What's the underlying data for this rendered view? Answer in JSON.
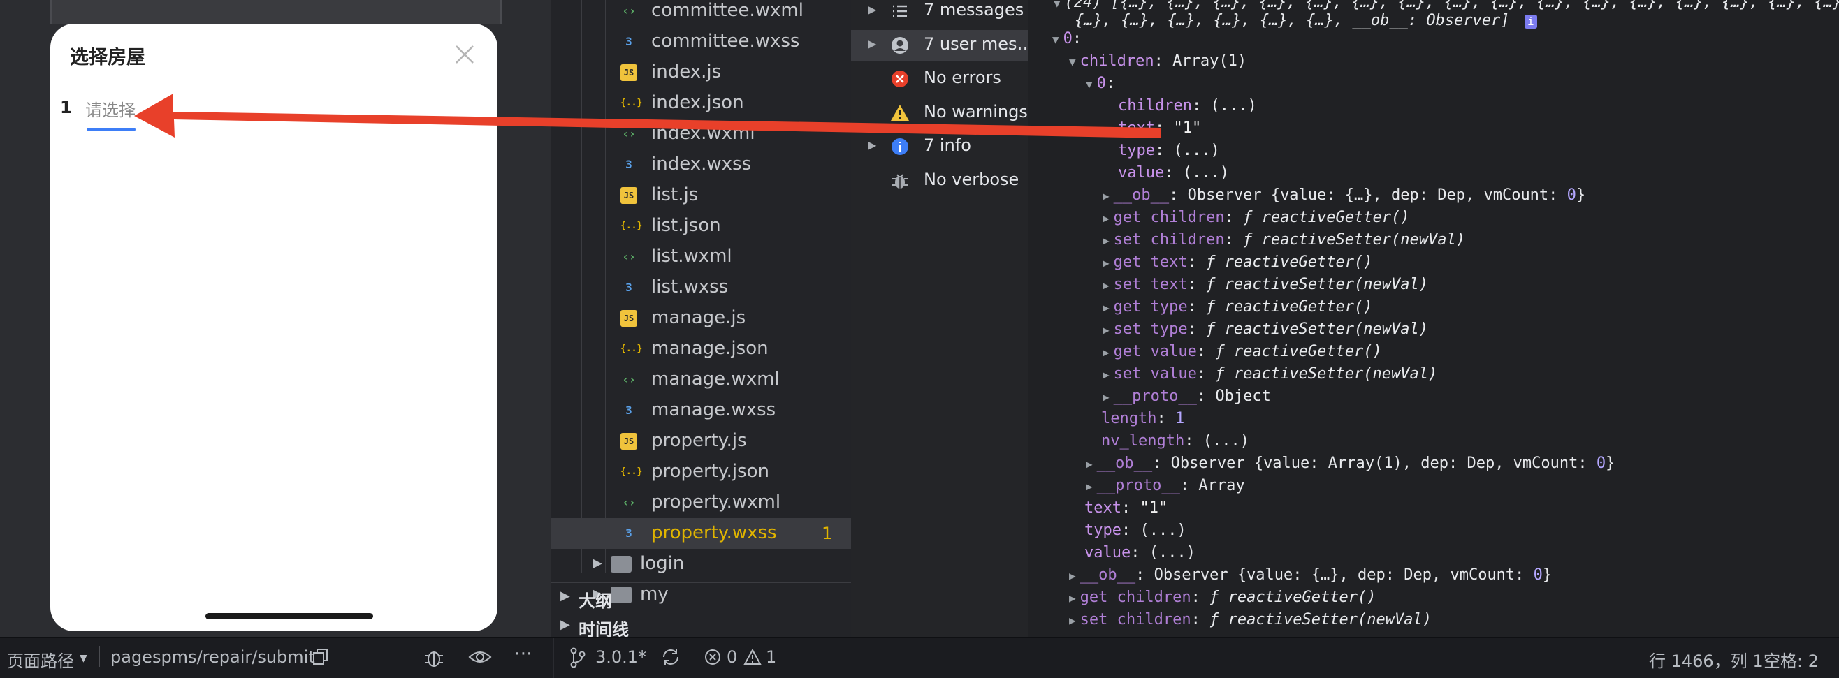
{
  "simulator": {
    "sheet_title": "选择房屋",
    "step_number": "1",
    "step_tab_label": "请选择"
  },
  "file_tree": {
    "files": [
      {
        "name": "committee.wxml",
        "type": "wxml"
      },
      {
        "name": "committee.wxss",
        "type": "wxss"
      },
      {
        "name": "index.js",
        "type": "js"
      },
      {
        "name": "index.json",
        "type": "json"
      },
      {
        "name": "index.wxml",
        "type": "wxml"
      },
      {
        "name": "index.wxss",
        "type": "wxss"
      },
      {
        "name": "list.js",
        "type": "js"
      },
      {
        "name": "list.json",
        "type": "json"
      },
      {
        "name": "list.wxml",
        "type": "wxml"
      },
      {
        "name": "list.wxss",
        "type": "wxss"
      },
      {
        "name": "manage.js",
        "type": "js"
      },
      {
        "name": "manage.json",
        "type": "json"
      },
      {
        "name": "manage.wxml",
        "type": "wxml"
      },
      {
        "name": "manage.wxss",
        "type": "wxss"
      },
      {
        "name": "property.js",
        "type": "js"
      },
      {
        "name": "property.json",
        "type": "json"
      },
      {
        "name": "property.wxml",
        "type": "wxml"
      },
      {
        "name": "property.wxss",
        "type": "wxss",
        "badge": "1",
        "selected": true
      }
    ],
    "folders": [
      "login",
      "my"
    ],
    "outline_label": "大纲",
    "timeline_label": "时间线"
  },
  "console_filters": [
    {
      "label": "7 messages",
      "icon": "list-icon",
      "expandable": true
    },
    {
      "label": "7 user mes…",
      "icon": "user-icon",
      "expandable": true,
      "selected": true
    },
    {
      "label": "No errors",
      "icon": "error-icon",
      "expandable": false
    },
    {
      "label": "No warnings",
      "icon": "warning-icon",
      "expandable": false
    },
    {
      "label": "7 info",
      "icon": "info-icon",
      "expandable": true
    },
    {
      "label": "No verbose",
      "icon": "bug-icon",
      "expandable": false
    }
  ],
  "console_output": {
    "header_line_1": "(24) [{…}, {…}, {…}, {…}, {…}, {…}, {…}, {…}, {…}, {…}, {…}, {…}, {…}, {…}, {…}, {…}, {…},",
    "header_line_2": "{…}, {…}, {…}, {…}, {…}, {…}, __ob__: Observer]",
    "info_badge": "i",
    "lines": [
      {
        "indent": 1,
        "tri": "down",
        "parts": [
          {
            "t": "0",
            "c": "k"
          },
          {
            "t": ":"
          }
        ]
      },
      {
        "indent": 2,
        "tri": "down",
        "parts": [
          {
            "t": "children",
            "c": "k"
          },
          {
            "t": ": Array(1)"
          }
        ]
      },
      {
        "indent": 3,
        "tri": "down",
        "parts": [
          {
            "t": "0",
            "c": "k"
          },
          {
            "t": ":"
          }
        ]
      },
      {
        "indent": 4,
        "tri": "",
        "parts": [
          {
            "t": "children",
            "c": "k"
          },
          {
            "t": ": (...)"
          }
        ]
      },
      {
        "indent": 4,
        "tri": "",
        "parts": [
          {
            "t": "text",
            "c": "k"
          },
          {
            "t": ": "
          },
          {
            "t": "\"1\"",
            "c": "s"
          }
        ]
      },
      {
        "indent": 4,
        "tri": "",
        "parts": [
          {
            "t": "type",
            "c": "k"
          },
          {
            "t": ": (...)"
          }
        ]
      },
      {
        "indent": 4,
        "tri": "",
        "parts": [
          {
            "t": "value",
            "c": "k"
          },
          {
            "t": ": (...)"
          }
        ]
      },
      {
        "indent": 4,
        "tri": "right",
        "parts": [
          {
            "t": "__ob__",
            "c": "kd"
          },
          {
            "t": ": Observer {value: {…}, dep: Dep, vmCount: "
          },
          {
            "t": "0",
            "c": "n"
          },
          {
            "t": "}"
          }
        ]
      },
      {
        "indent": 4,
        "tri": "right",
        "parts": [
          {
            "t": "get children",
            "c": "kd"
          },
          {
            "t": ": "
          },
          {
            "t": "ƒ reactiveGetter()",
            "c": "f"
          }
        ]
      },
      {
        "indent": 4,
        "tri": "right",
        "parts": [
          {
            "t": "set children",
            "c": "kd"
          },
          {
            "t": ": "
          },
          {
            "t": "ƒ reactiveSetter(newVal)",
            "c": "f"
          }
        ]
      },
      {
        "indent": 4,
        "tri": "right",
        "parts": [
          {
            "t": "get text",
            "c": "kd"
          },
          {
            "t": ": "
          },
          {
            "t": "ƒ reactiveGetter()",
            "c": "f"
          }
        ]
      },
      {
        "indent": 4,
        "tri": "right",
        "parts": [
          {
            "t": "set text",
            "c": "kd"
          },
          {
            "t": ": "
          },
          {
            "t": "ƒ reactiveSetter(newVal)",
            "c": "f"
          }
        ]
      },
      {
        "indent": 4,
        "tri": "right",
        "parts": [
          {
            "t": "get type",
            "c": "kd"
          },
          {
            "t": ": "
          },
          {
            "t": "ƒ reactiveGetter()",
            "c": "f"
          }
        ]
      },
      {
        "indent": 4,
        "tri": "right",
        "parts": [
          {
            "t": "set type",
            "c": "kd"
          },
          {
            "t": ": "
          },
          {
            "t": "ƒ reactiveSetter(newVal)",
            "c": "f"
          }
        ]
      },
      {
        "indent": 4,
        "tri": "right",
        "parts": [
          {
            "t": "get value",
            "c": "kd"
          },
          {
            "t": ": "
          },
          {
            "t": "ƒ reactiveGetter()",
            "c": "f"
          }
        ]
      },
      {
        "indent": 4,
        "tri": "right",
        "parts": [
          {
            "t": "set value",
            "c": "kd"
          },
          {
            "t": ": "
          },
          {
            "t": "ƒ reactiveSetter(newVal)",
            "c": "f"
          }
        ]
      },
      {
        "indent": 4,
        "tri": "right",
        "parts": [
          {
            "t": "__proto__",
            "c": "kd"
          },
          {
            "t": ": Object"
          }
        ]
      },
      {
        "indent": 3,
        "tri": "",
        "parts": [
          {
            "t": "length",
            "c": "kd"
          },
          {
            "t": ": "
          },
          {
            "t": "1",
            "c": "n"
          }
        ]
      },
      {
        "indent": 3,
        "tri": "",
        "parts": [
          {
            "t": "nv_length",
            "c": "kd"
          },
          {
            "t": ": (...)"
          }
        ]
      },
      {
        "indent": 3,
        "tri": "right",
        "parts": [
          {
            "t": "__ob__",
            "c": "kd"
          },
          {
            "t": ": Observer {value: Array(1), dep: Dep, vmCount: "
          },
          {
            "t": "0",
            "c": "n"
          },
          {
            "t": "}"
          }
        ]
      },
      {
        "indent": 3,
        "tri": "right",
        "parts": [
          {
            "t": "__proto__",
            "c": "kd"
          },
          {
            "t": ": Array"
          }
        ]
      },
      {
        "indent": 2,
        "tri": "",
        "parts": [
          {
            "t": "text",
            "c": "k"
          },
          {
            "t": ": "
          },
          {
            "t": "\"1\"",
            "c": "s"
          }
        ]
      },
      {
        "indent": 2,
        "tri": "",
        "parts": [
          {
            "t": "type",
            "c": "k"
          },
          {
            "t": ": (...)"
          }
        ]
      },
      {
        "indent": 2,
        "tri": "",
        "parts": [
          {
            "t": "value",
            "c": "k"
          },
          {
            "t": ": (...)"
          }
        ]
      },
      {
        "indent": 2,
        "tri": "right",
        "parts": [
          {
            "t": "__ob__",
            "c": "kd"
          },
          {
            "t": ": Observer {value: {…}, dep: Dep, vmCount: "
          },
          {
            "t": "0",
            "c": "n"
          },
          {
            "t": "}"
          }
        ]
      },
      {
        "indent": 2,
        "tri": "right",
        "parts": [
          {
            "t": "get children",
            "c": "kd"
          },
          {
            "t": ": "
          },
          {
            "t": "ƒ reactiveGetter()",
            "c": "f"
          }
        ]
      },
      {
        "indent": 2,
        "tri": "right",
        "parts": [
          {
            "t": "set children",
            "c": "kd"
          },
          {
            "t": ": "
          },
          {
            "t": "ƒ reactiveSetter(newVal)",
            "c": "f"
          }
        ]
      }
    ]
  },
  "status_bar": {
    "page_path_label": "页面路径",
    "page_path_value": "pagespms/repair/submit",
    "git_branch": "3.0.1*",
    "errors_count": "0",
    "warnings_count": "1",
    "cursor_position": "行 1466，列 1",
    "indent_info": "空格: 2"
  },
  "colors": {
    "accent_blue": "#3d7ef7",
    "arrow_red": "#e8402a",
    "badge_yellow": "#e0b400"
  }
}
